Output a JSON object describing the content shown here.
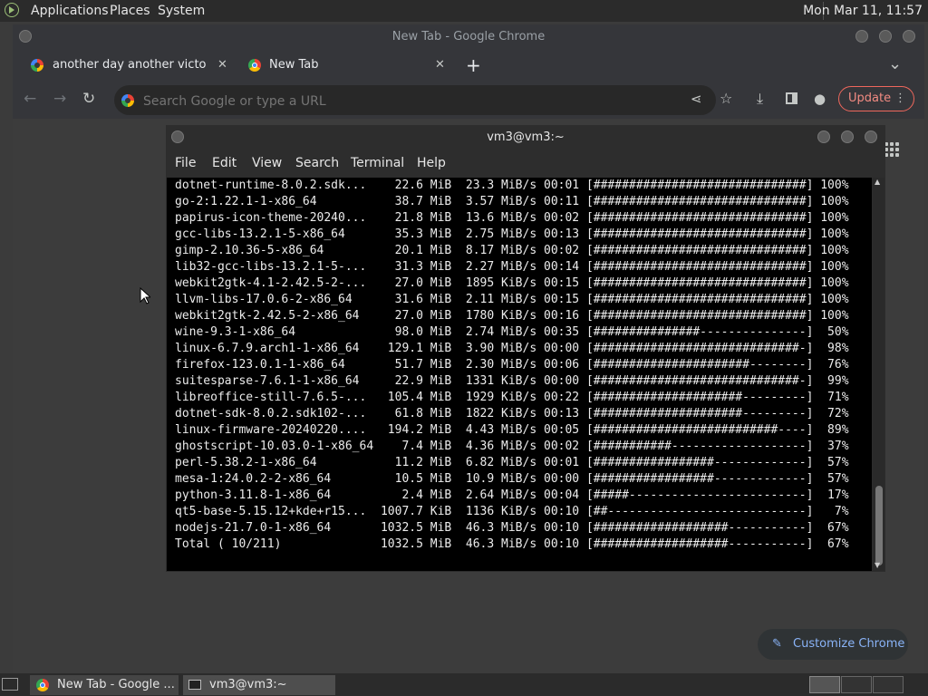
{
  "top_panel": {
    "menus": [
      "Applications",
      "Places",
      "System"
    ],
    "clock": "Mon Mar 11, 11:57"
  },
  "chrome": {
    "window_title": "New Tab - Google Chrome",
    "tabs": [
      {
        "label": "another day another victory for"
      },
      {
        "label": "New Tab"
      }
    ],
    "new_tab_symbol": "+",
    "tab_search_symbol": "⌄",
    "omnibox_placeholder": "Search Google or type a URL",
    "update_label": "Update",
    "customize_label": "Customize Chrome"
  },
  "terminal": {
    "title": "vm3@vm3:~",
    "menus": [
      "File",
      "Edit",
      "View",
      "Search",
      "Terminal",
      "Help"
    ],
    "lines": [
      "dotnet-runtime-8.0.2.sdk...    22.6 MiB  23.3 MiB/s 00:01 [##############################] 100%",
      "go-2:1.22.1-1-x86_64           38.7 MiB  3.57 MiB/s 00:11 [##############################] 100%",
      "papirus-icon-theme-20240...    21.8 MiB  13.6 MiB/s 00:02 [##############################] 100%",
      "gcc-libs-13.2.1-5-x86_64       35.3 MiB  2.75 MiB/s 00:13 [##############################] 100%",
      "gimp-2.10.36-5-x86_64          20.1 MiB  8.17 MiB/s 00:02 [##############################] 100%",
      "lib32-gcc-libs-13.2.1-5-...    31.3 MiB  2.27 MiB/s 00:14 [##############################] 100%",
      "webkit2gtk-4.1-2.42.5-2-...    27.0 MiB  1895 KiB/s 00:15 [##############################] 100%",
      "llvm-libs-17.0.6-2-x86_64      31.6 MiB  2.11 MiB/s 00:15 [##############################] 100%",
      "webkit2gtk-2.42.5-2-x86_64     27.0 MiB  1780 KiB/s 00:16 [##############################] 100%",
      "wine-9.3-1-x86_64              98.0 MiB  2.74 MiB/s 00:35 [###############---------------]  50%",
      "linux-6.7.9.arch1-1-x86_64    129.1 MiB  3.90 MiB/s 00:00 [#############################-]  98%",
      "firefox-123.0.1-1-x86_64       51.7 MiB  2.30 MiB/s 00:06 [######################--------]  76%",
      "suitesparse-7.6.1-1-x86_64     22.9 MiB  1331 KiB/s 00:00 [#############################-]  99%",
      "libreoffice-still-7.6.5-...   105.4 MiB  1929 KiB/s 00:22 [#####################---------]  71%",
      "dotnet-sdk-8.0.2.sdk102-...    61.8 MiB  1822 KiB/s 00:13 [#####################---------]  72%",
      "linux-firmware-20240220....   194.2 MiB  4.43 MiB/s 00:05 [##########################----]  89%",
      "ghostscript-10.03.0-1-x86_64    7.4 MiB  4.36 MiB/s 00:02 [###########-------------------]  37%",
      "perl-5.38.2-1-x86_64           11.2 MiB  6.82 MiB/s 00:01 [#################-------------]  57%",
      "mesa-1:24.0.2-2-x86_64         10.5 MiB  10.9 MiB/s 00:00 [#################-------------]  57%",
      "python-3.11.8-1-x86_64          2.4 MiB  2.64 MiB/s 00:04 [#####-------------------------]  17%",
      "qt5-base-5.15.12+kde+r15...  1007.7 KiB  1136 KiB/s 00:10 [##----------------------------]   7%",
      "nodejs-21.7.0-1-x86_64       1032.5 MiB  46.3 MiB/s 00:10 [###################-----------]  67%",
      "Total ( 10/211)              1032.5 MiB  46.3 MiB/s 00:10 [###################-----------]  67%"
    ]
  },
  "taskbar": {
    "items": [
      "New Tab - Google ...",
      "vm3@vm3:~"
    ]
  }
}
